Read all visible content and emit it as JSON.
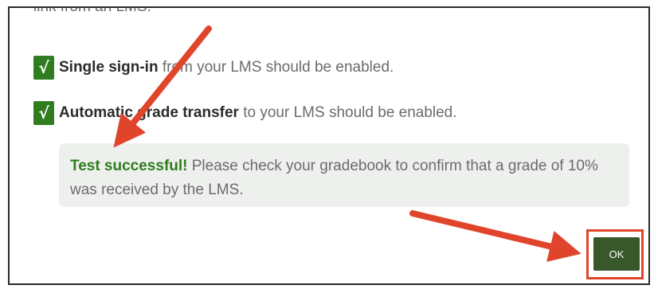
{
  "dialog": {
    "top_text": "link from an LMS.",
    "items": [
      {
        "bold": "Single sign-in",
        "rest": " from your LMS should be enabled.",
        "check": "√"
      },
      {
        "bold": "Automatic grade transfer",
        "rest": " to your LMS should be enabled.",
        "check": "√"
      }
    ],
    "result": {
      "status": "Test successful!",
      "message": " Please check your gradebook to confirm that a grade of 10% was received by the LMS."
    },
    "ok_label": "OK"
  },
  "colors": {
    "accent_green": "#2f7d1f",
    "button_green": "#38582a",
    "annotation_red": "#e0452c"
  },
  "icons": [
    "checkmark-icon",
    "annotation-arrow-icon"
  ]
}
